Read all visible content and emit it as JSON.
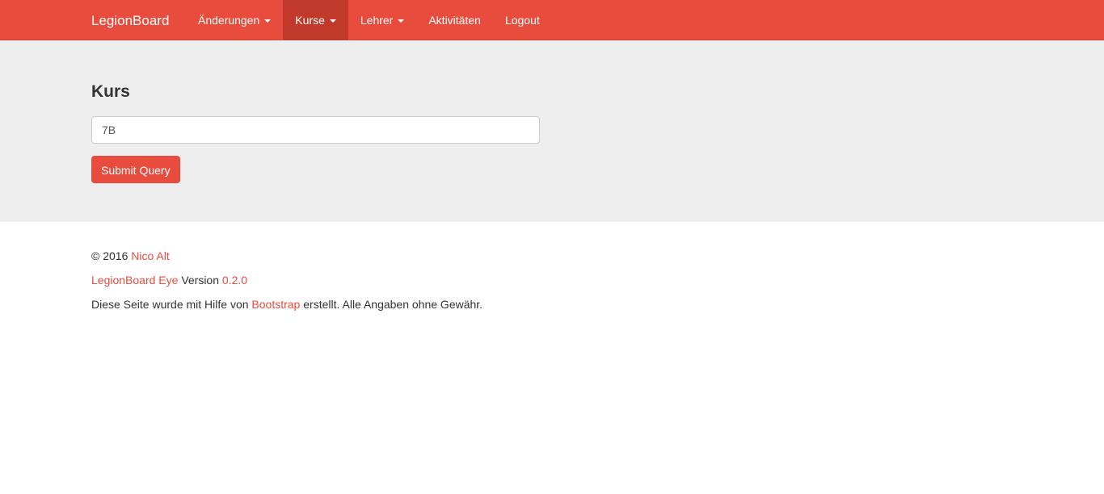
{
  "navbar": {
    "brand": "LegionBoard",
    "items": [
      {
        "label": "Änderungen",
        "dropdown": true,
        "active": false
      },
      {
        "label": "Kurse",
        "dropdown": true,
        "active": true
      },
      {
        "label": "Lehrer",
        "dropdown": true,
        "active": false
      },
      {
        "label": "Aktivitäten",
        "dropdown": false,
        "active": false
      },
      {
        "label": "Logout",
        "dropdown": false,
        "active": false
      }
    ]
  },
  "form": {
    "heading": "Kurs",
    "course_value": "7B",
    "submit_label": "Submit Query"
  },
  "footer": {
    "copyright_prefix": "© 2016",
    "author_link": "Nico Alt",
    "app_link": "LegionBoard Eye",
    "version_label": "Version",
    "version_link": "0.2.0",
    "credits_prefix": "Diese Seite wurde mit Hilfe von",
    "bootstrap_link": "Bootstrap",
    "credits_suffix": "erstellt. Alle Angaben ohne Gewähr."
  },
  "colors": {
    "brand": "#e74c3c",
    "brand_active": "#c0392b",
    "hero_bg": "#eeeeee"
  }
}
